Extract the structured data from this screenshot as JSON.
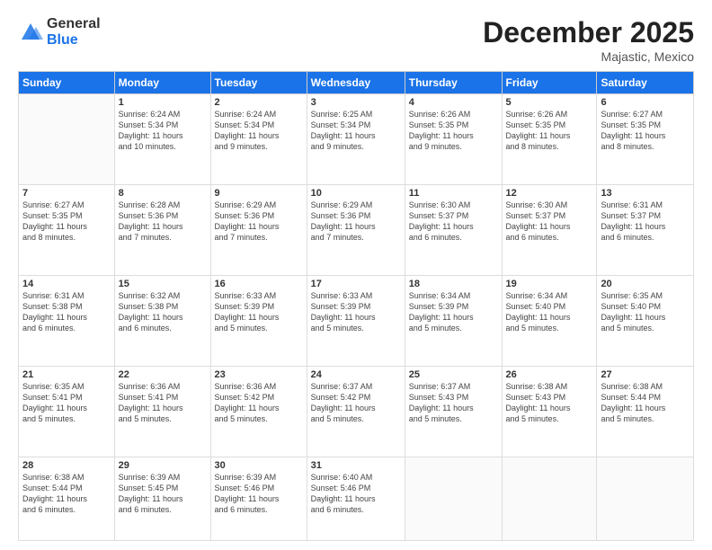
{
  "header": {
    "logo_general": "General",
    "logo_blue": "Blue",
    "month_title": "December 2025",
    "location": "Majastic, Mexico"
  },
  "days_of_week": [
    "Sunday",
    "Monday",
    "Tuesday",
    "Wednesday",
    "Thursday",
    "Friday",
    "Saturday"
  ],
  "weeks": [
    [
      {
        "day": "",
        "lines": []
      },
      {
        "day": "1",
        "lines": [
          "Sunrise: 6:24 AM",
          "Sunset: 5:34 PM",
          "Daylight: 11 hours",
          "and 10 minutes."
        ]
      },
      {
        "day": "2",
        "lines": [
          "Sunrise: 6:24 AM",
          "Sunset: 5:34 PM",
          "Daylight: 11 hours",
          "and 9 minutes."
        ]
      },
      {
        "day": "3",
        "lines": [
          "Sunrise: 6:25 AM",
          "Sunset: 5:34 PM",
          "Daylight: 11 hours",
          "and 9 minutes."
        ]
      },
      {
        "day": "4",
        "lines": [
          "Sunrise: 6:26 AM",
          "Sunset: 5:35 PM",
          "Daylight: 11 hours",
          "and 9 minutes."
        ]
      },
      {
        "day": "5",
        "lines": [
          "Sunrise: 6:26 AM",
          "Sunset: 5:35 PM",
          "Daylight: 11 hours",
          "and 8 minutes."
        ]
      },
      {
        "day": "6",
        "lines": [
          "Sunrise: 6:27 AM",
          "Sunset: 5:35 PM",
          "Daylight: 11 hours",
          "and 8 minutes."
        ]
      }
    ],
    [
      {
        "day": "7",
        "lines": [
          "Sunrise: 6:27 AM",
          "Sunset: 5:35 PM",
          "Daylight: 11 hours",
          "and 8 minutes."
        ]
      },
      {
        "day": "8",
        "lines": [
          "Sunrise: 6:28 AM",
          "Sunset: 5:36 PM",
          "Daylight: 11 hours",
          "and 7 minutes."
        ]
      },
      {
        "day": "9",
        "lines": [
          "Sunrise: 6:29 AM",
          "Sunset: 5:36 PM",
          "Daylight: 11 hours",
          "and 7 minutes."
        ]
      },
      {
        "day": "10",
        "lines": [
          "Sunrise: 6:29 AM",
          "Sunset: 5:36 PM",
          "Daylight: 11 hours",
          "and 7 minutes."
        ]
      },
      {
        "day": "11",
        "lines": [
          "Sunrise: 6:30 AM",
          "Sunset: 5:37 PM",
          "Daylight: 11 hours",
          "and 6 minutes."
        ]
      },
      {
        "day": "12",
        "lines": [
          "Sunrise: 6:30 AM",
          "Sunset: 5:37 PM",
          "Daylight: 11 hours",
          "and 6 minutes."
        ]
      },
      {
        "day": "13",
        "lines": [
          "Sunrise: 6:31 AM",
          "Sunset: 5:37 PM",
          "Daylight: 11 hours",
          "and 6 minutes."
        ]
      }
    ],
    [
      {
        "day": "14",
        "lines": [
          "Sunrise: 6:31 AM",
          "Sunset: 5:38 PM",
          "Daylight: 11 hours",
          "and 6 minutes."
        ]
      },
      {
        "day": "15",
        "lines": [
          "Sunrise: 6:32 AM",
          "Sunset: 5:38 PM",
          "Daylight: 11 hours",
          "and 6 minutes."
        ]
      },
      {
        "day": "16",
        "lines": [
          "Sunrise: 6:33 AM",
          "Sunset: 5:39 PM",
          "Daylight: 11 hours",
          "and 5 minutes."
        ]
      },
      {
        "day": "17",
        "lines": [
          "Sunrise: 6:33 AM",
          "Sunset: 5:39 PM",
          "Daylight: 11 hours",
          "and 5 minutes."
        ]
      },
      {
        "day": "18",
        "lines": [
          "Sunrise: 6:34 AM",
          "Sunset: 5:39 PM",
          "Daylight: 11 hours",
          "and 5 minutes."
        ]
      },
      {
        "day": "19",
        "lines": [
          "Sunrise: 6:34 AM",
          "Sunset: 5:40 PM",
          "Daylight: 11 hours",
          "and 5 minutes."
        ]
      },
      {
        "day": "20",
        "lines": [
          "Sunrise: 6:35 AM",
          "Sunset: 5:40 PM",
          "Daylight: 11 hours",
          "and 5 minutes."
        ]
      }
    ],
    [
      {
        "day": "21",
        "lines": [
          "Sunrise: 6:35 AM",
          "Sunset: 5:41 PM",
          "Daylight: 11 hours",
          "and 5 minutes."
        ]
      },
      {
        "day": "22",
        "lines": [
          "Sunrise: 6:36 AM",
          "Sunset: 5:41 PM",
          "Daylight: 11 hours",
          "and 5 minutes."
        ]
      },
      {
        "day": "23",
        "lines": [
          "Sunrise: 6:36 AM",
          "Sunset: 5:42 PM",
          "Daylight: 11 hours",
          "and 5 minutes."
        ]
      },
      {
        "day": "24",
        "lines": [
          "Sunrise: 6:37 AM",
          "Sunset: 5:42 PM",
          "Daylight: 11 hours",
          "and 5 minutes."
        ]
      },
      {
        "day": "25",
        "lines": [
          "Sunrise: 6:37 AM",
          "Sunset: 5:43 PM",
          "Daylight: 11 hours",
          "and 5 minutes."
        ]
      },
      {
        "day": "26",
        "lines": [
          "Sunrise: 6:38 AM",
          "Sunset: 5:43 PM",
          "Daylight: 11 hours",
          "and 5 minutes."
        ]
      },
      {
        "day": "27",
        "lines": [
          "Sunrise: 6:38 AM",
          "Sunset: 5:44 PM",
          "Daylight: 11 hours",
          "and 5 minutes."
        ]
      }
    ],
    [
      {
        "day": "28",
        "lines": [
          "Sunrise: 6:38 AM",
          "Sunset: 5:44 PM",
          "Daylight: 11 hours",
          "and 6 minutes."
        ]
      },
      {
        "day": "29",
        "lines": [
          "Sunrise: 6:39 AM",
          "Sunset: 5:45 PM",
          "Daylight: 11 hours",
          "and 6 minutes."
        ]
      },
      {
        "day": "30",
        "lines": [
          "Sunrise: 6:39 AM",
          "Sunset: 5:46 PM",
          "Daylight: 11 hours",
          "and 6 minutes."
        ]
      },
      {
        "day": "31",
        "lines": [
          "Sunrise: 6:40 AM",
          "Sunset: 5:46 PM",
          "Daylight: 11 hours",
          "and 6 minutes."
        ]
      },
      {
        "day": "",
        "lines": []
      },
      {
        "day": "",
        "lines": []
      },
      {
        "day": "",
        "lines": []
      }
    ]
  ]
}
